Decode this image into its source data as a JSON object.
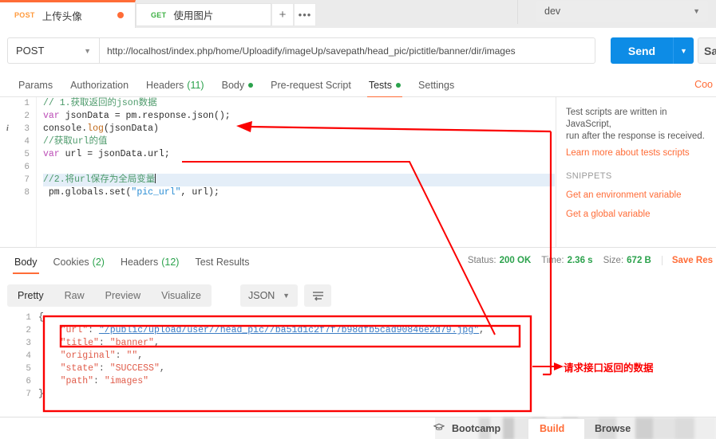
{
  "tabbar": {
    "tabs": [
      {
        "verb": "POST",
        "title": "上传头像",
        "unsaved": true,
        "active": true
      },
      {
        "verb": "GET",
        "title": "使用图片",
        "unsaved": false,
        "active": false
      }
    ],
    "new_tab_label": "+",
    "more_label": "•••",
    "environment": {
      "value": "dev",
      "caret": "▼"
    }
  },
  "request": {
    "method": "POST",
    "method_caret": "▼",
    "url": "http://localhost/index.php/home/Uploadify/imageUp/savepath/head_pic/pictitle/banner/dir/images",
    "send_label": "Send",
    "send_caret": "▼",
    "save_label": "Sa",
    "tabs": [
      {
        "label": "Params",
        "active": false
      },
      {
        "label": "Authorization",
        "active": false
      },
      {
        "label": "Headers",
        "count": "(11)",
        "active": false
      },
      {
        "label": "Body",
        "dot": true,
        "active": false
      },
      {
        "label": "Pre-request Script",
        "active": false
      },
      {
        "label": "Tests",
        "dot": true,
        "active": true
      },
      {
        "label": "Settings",
        "active": false
      }
    ],
    "cookies_link": "Coo"
  },
  "editor": {
    "line_numbers": [
      "1",
      "2",
      "3",
      "4",
      "5",
      "6",
      "7",
      "8"
    ],
    "warn_icon_line": 3,
    "warn_glyph": "i",
    "lines": [
      {
        "n": 1,
        "segments": [
          {
            "t": "// 1.获取返回的json数据",
            "c": "cmt"
          }
        ]
      },
      {
        "n": 2,
        "segments": [
          {
            "t": "var ",
            "c": "kw"
          },
          {
            "t": "jsonData = pm.response.json();",
            "c": "pln"
          }
        ]
      },
      {
        "n": 3,
        "segments": [
          {
            "t": "console.",
            "c": "pln"
          },
          {
            "t": "log",
            "c": "fn"
          },
          {
            "t": "(jsonData)",
            "c": "pln"
          }
        ]
      },
      {
        "n": 4,
        "segments": [
          {
            "t": "//获取url的值",
            "c": "cmt"
          }
        ]
      },
      {
        "n": 5,
        "segments": [
          {
            "t": "var ",
            "c": "kw"
          },
          {
            "t": "url = jsonData.url;",
            "c": "pln"
          }
        ]
      },
      {
        "n": 6,
        "segments": [
          {
            "t": "",
            "c": "pln"
          }
        ]
      },
      {
        "n": 7,
        "highlight": true,
        "segments": [
          {
            "t": "//2.将url保存为全局变量",
            "c": "cmt"
          }
        ]
      },
      {
        "n": 8,
        "segments": [
          {
            "t": " pm.globals.set(",
            "c": "pln"
          },
          {
            "t": "\"pic_url\"",
            "c": "str"
          },
          {
            "t": ", url);",
            "c": "pln"
          }
        ]
      }
    ]
  },
  "snippets": {
    "description_line1": "Test scripts are written in JavaScript,",
    "description_line2": "run after the response is received.",
    "learn_more": "Learn more about tests scripts",
    "heading": "SNIPPETS",
    "items": [
      "Get an environment variable",
      "Get a global variable"
    ]
  },
  "response": {
    "tabs": [
      {
        "label": "Body",
        "active": true
      },
      {
        "label": "Cookies",
        "count": "(2)",
        "active": false
      },
      {
        "label": "Headers",
        "count": "(12)",
        "active": false
      },
      {
        "label": "Test Results",
        "active": false
      }
    ],
    "status_label": "Status:",
    "status_value": "200 OK",
    "time_label": "Time:",
    "time_value": "2.36 s",
    "size_label": "Size:",
    "size_value": "672 B",
    "save_response": "Save Res",
    "format_tabs": [
      {
        "label": "Pretty",
        "active": true
      },
      {
        "label": "Raw",
        "active": false
      },
      {
        "label": "Preview",
        "active": false
      },
      {
        "label": "Visualize",
        "active": false
      }
    ],
    "format_type": "JSON",
    "format_caret": "▼",
    "wrap_icon": "wrap-lines-icon",
    "body": {
      "line_numbers": [
        "1",
        "2",
        "3",
        "4",
        "5",
        "6",
        "7"
      ],
      "lines": [
        {
          "n": 1,
          "text": "{"
        },
        {
          "n": 2,
          "key": "\"url\"",
          "sep": ": ",
          "value": "\"/public/upload/user//head_pic//ba51d1c2f7f7b98dfb5cad90846e2d79.jpg\"",
          "trail": ",",
          "url_style": true
        },
        {
          "n": 3,
          "key": "\"title\"",
          "sep": ": ",
          "value": "\"banner\"",
          "trail": ","
        },
        {
          "n": 4,
          "key": "\"original\"",
          "sep": ": ",
          "value": "\"\"",
          "trail": ","
        },
        {
          "n": 5,
          "key": "\"state\"",
          "sep": ": ",
          "value": "\"SUCCESS\"",
          "trail": ","
        },
        {
          "n": 6,
          "key": "\"path\"",
          "sep": ": ",
          "value": "\"images\"",
          "trail": ""
        },
        {
          "n": 7,
          "text": "}"
        }
      ]
    }
  },
  "annotations": {
    "callout_text": "请求接口返回的数据",
    "color": "#fb0000"
  },
  "bottombar": {
    "bootcamp_icon": "graduation-cap-icon",
    "bootcamp": "Bootcamp",
    "build": "Build",
    "browse": "Browse"
  }
}
